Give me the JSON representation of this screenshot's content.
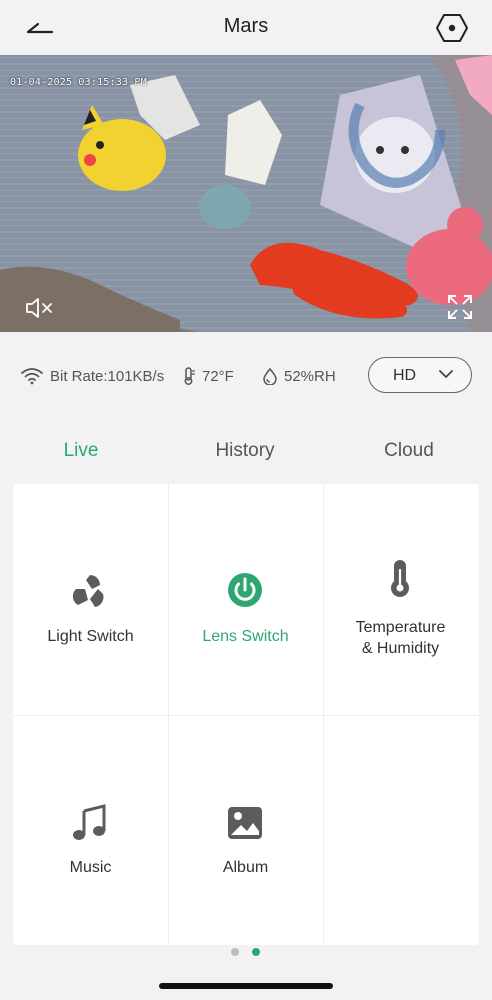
{
  "header": {
    "title": "Mars"
  },
  "video": {
    "timestamp": "01-04-2025 03:15:33 PM"
  },
  "info": {
    "bitrate": "Bit Rate:101KB/s",
    "temperature": "72°F",
    "humidity": "52%RH",
    "quality": "HD"
  },
  "tabs": [
    {
      "label": "Live",
      "active": true
    },
    {
      "label": "History",
      "active": false
    },
    {
      "label": "Cloud",
      "active": false
    }
  ],
  "features": [
    {
      "label": "Light Switch",
      "icon": "light-switch-icon"
    },
    {
      "label": "Lens Switch",
      "icon": "power-icon",
      "active": true
    },
    {
      "label": "Temperature\n& Humidity",
      "icon": "thermometer-icon"
    },
    {
      "label": "Music",
      "icon": "music-note-icon"
    },
    {
      "label": "Album",
      "icon": "image-icon"
    }
  ],
  "pager": {
    "pages": 2,
    "current": 2
  },
  "colors": {
    "accent": "#2fa672",
    "background": "#f2f2f4",
    "icon": "#5c5c5c"
  }
}
